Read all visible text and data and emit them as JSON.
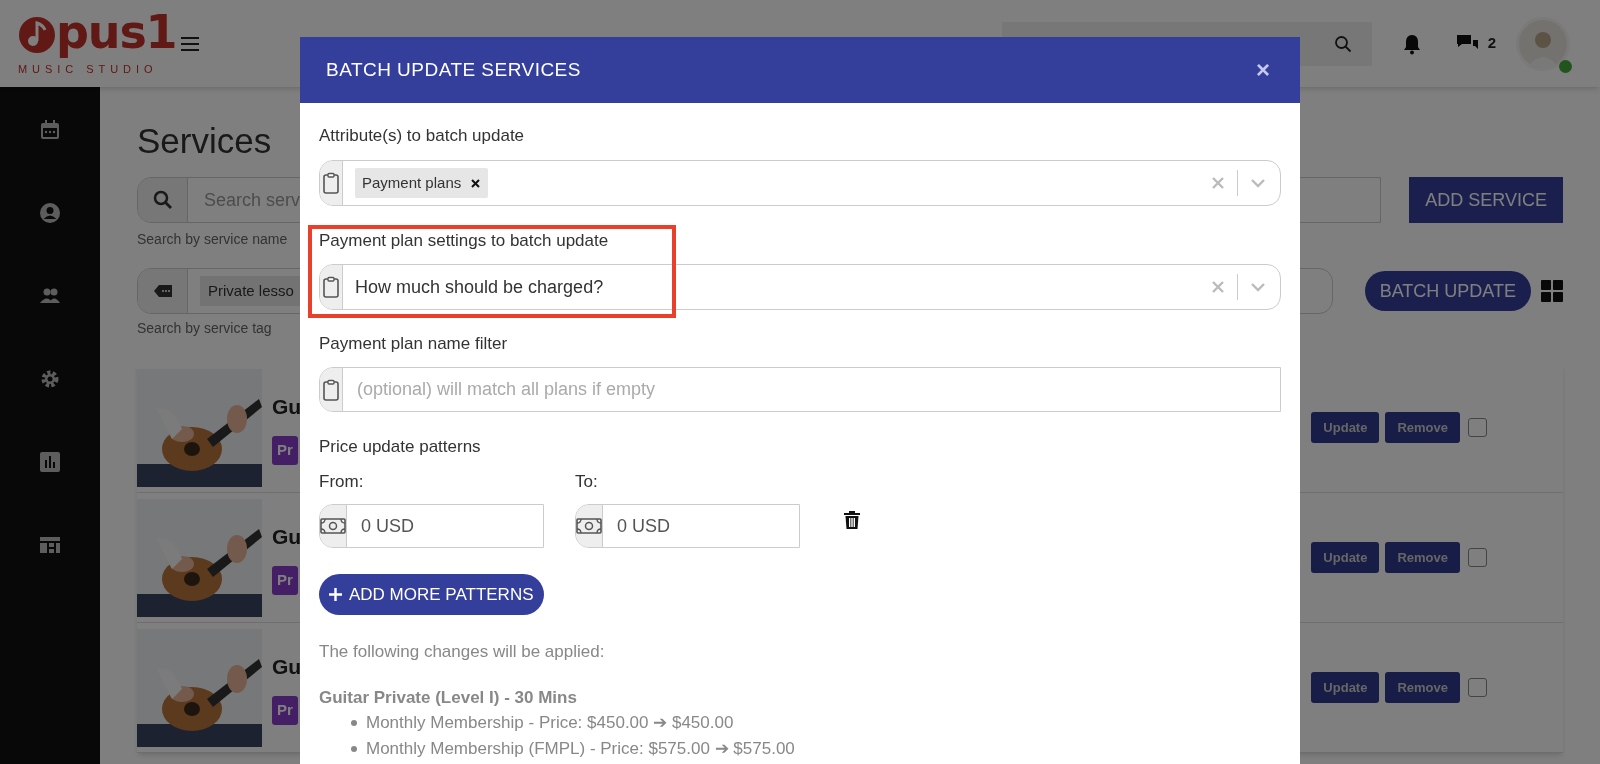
{
  "header": {
    "logo_text": "pus1",
    "logo_subtitle": "MUSIC STUDIO",
    "messages_count": "2",
    "online": true
  },
  "page": {
    "title": "Services",
    "search": {
      "placeholder": "Search serv"
    },
    "search_hint": "Search by service name",
    "tag_filter": {
      "value": "Private lesso"
    },
    "tag_hint": "Search by service tag",
    "add_button": "ADD SERVICE",
    "batch_button": "BATCH UPDATE",
    "services": [
      {
        "title": "Gu",
        "badge": "Pr",
        "update": "Update",
        "remove": "Remove",
        "checked": false
      },
      {
        "title": "Gu",
        "badge": "Pr",
        "update": "Update",
        "remove": "Remove",
        "checked": false
      },
      {
        "title": "Gu",
        "badge": "Pr",
        "update": "Update",
        "remove": "Remove",
        "checked": false
      }
    ]
  },
  "modal": {
    "title": "BATCH UPDATE SERVICES",
    "close": "×",
    "attributes": {
      "label": "Attribute(s) to batch update",
      "chips": [
        "Payment plans"
      ]
    },
    "settings": {
      "label": "Payment plan settings to batch update",
      "value": "How much should be charged?",
      "highlighted": true
    },
    "name_filter": {
      "label": "Payment plan name filter",
      "placeholder": "(optional) will match all plans if empty"
    },
    "patterns": {
      "label": "Price update patterns",
      "from_label": "From:",
      "to_label": "To:",
      "rows": [
        {
          "from": "0 USD",
          "to": "0 USD"
        }
      ]
    },
    "add_button": "ADD MORE PATTERNS",
    "changes_intro": "The following changes will be applied:",
    "changes": [
      {
        "service": "Guitar Private (Level I) - 30 Mins",
        "items": [
          "Monthly Membership - Price: $450.00 ➔ $450.00",
          "Monthly Membership (FMPL) - Price: $575.00 ➔ $575.00"
        ]
      }
    ]
  }
}
